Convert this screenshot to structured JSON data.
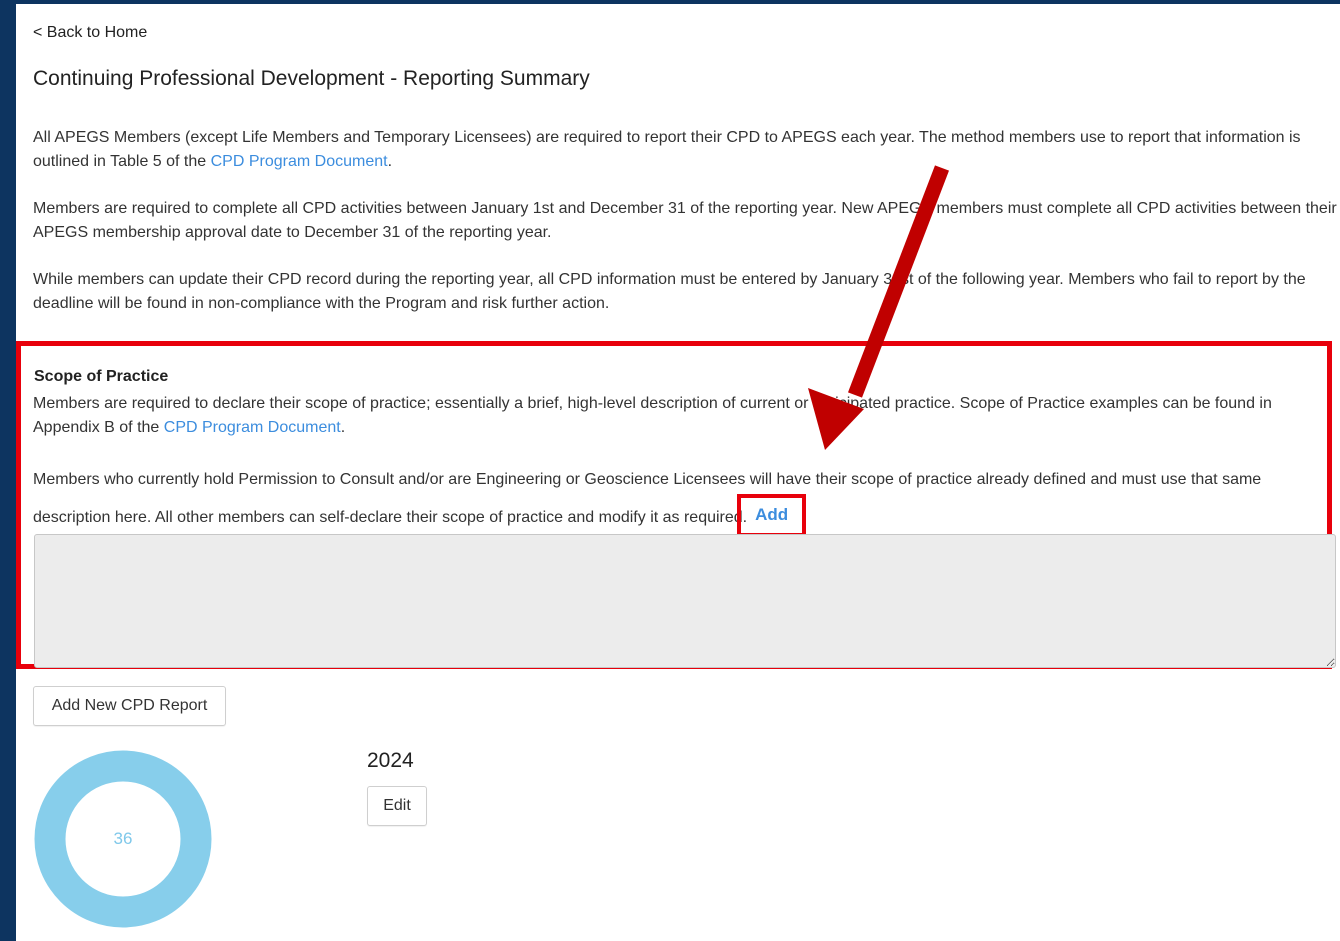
{
  "nav": {
    "back_label": "< Back to Home"
  },
  "page_title": "Continuing Professional Development - Reporting Summary",
  "intro": {
    "p1_text": "All APEGS Members (except Life Members and Temporary Licensees) are required to report their CPD to APEGS each year. The method members use to report that information is outlined in Table 5 of the ",
    "p1_link": "CPD Program Document",
    "p1_end": ".",
    "p2_text": "Members are required to complete all CPD activities between January 1st and December 31 of the reporting year. New APEGS members must complete all CPD activities between their APEGS membership approval date to December 31 of the reporting year.",
    "p3_text": "While members can update their CPD record during the reporting year, all CPD information must be entered by January 31st of the following year. Members who fail to report by the deadline will be found in non-compliance with the Program and risk further action."
  },
  "scope": {
    "title": "Scope of Practice",
    "p1_text": "Members are required to declare their scope of practice; essentially a brief, high-level description of current or anticipated practice. Scope of Practice examples can be found in Appendix B of the ",
    "p1_link": "CPD Program Document",
    "p1_end": ".",
    "p2_text": "Members who currently hold Permission to Consult and/or are Engineering or Geoscience Licensees will have their scope of practice already defined and must use that same description here. All other members can self-declare their scope of practice and modify it as required.",
    "add_label": "Add",
    "textarea_value": ""
  },
  "actions": {
    "add_report_label": "Add New CPD Report"
  },
  "report": {
    "year": "2024",
    "edit_label": "Edit",
    "total_value": "36"
  },
  "colors": {
    "background": "#0d3460",
    "highlight": "#e8000b",
    "arrow": "#c00000",
    "link": "#3c8dde",
    "donut": "#87ceeb"
  }
}
